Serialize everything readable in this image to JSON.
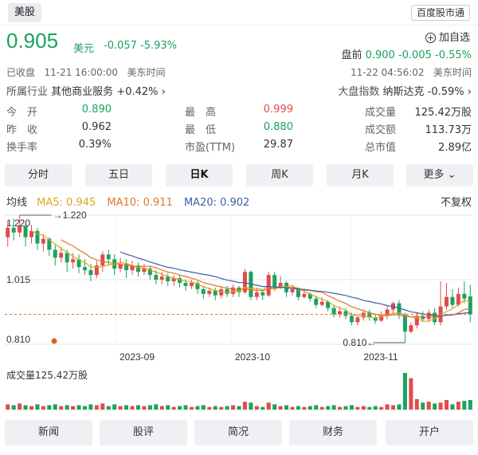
{
  "header": {
    "tab": "美股",
    "brand": "百度股市通"
  },
  "quote": {
    "price": "0.905",
    "unit": "美元",
    "change": "-0.057 -5.93%",
    "status": "已收盘",
    "time": "11-21 16:00:00",
    "tz": "美东时间",
    "watch_label": "加自选",
    "premarket_label": "盘前",
    "premarket_value": "0.900 -0.005 -0.55%",
    "premarket_time": "11-22 04:56:02",
    "premarket_tz": "美东时间"
  },
  "industry": {
    "label": "所属行业",
    "name": "其他商业服务",
    "change": "+0.42%",
    "arrow": "›"
  },
  "index": {
    "label": "大盘指数",
    "name": "纳斯达克",
    "change": "-0.59%",
    "arrow": "›"
  },
  "stats": [
    [
      {
        "k": "今　开",
        "v": "0.890",
        "color": "#1aa260"
      },
      {
        "k": "最　高",
        "v": "0.999",
        "color": "#e24b4b"
      },
      {
        "k": "成交量",
        "v": "125.42万股",
        "color": "#333333"
      }
    ],
    [
      {
        "k": "昨　收",
        "v": "0.962",
        "color": "#333333"
      },
      {
        "k": "最　低",
        "v": "0.880",
        "color": "#1aa260"
      },
      {
        "k": "成交额",
        "v": "113.73万",
        "color": "#333333"
      }
    ],
    [
      {
        "k": "换手率",
        "v": "0.39%",
        "color": "#333333"
      },
      {
        "k": "市盈(TTM)",
        "v": "29.87",
        "color": "#333333"
      },
      {
        "k": "总市值",
        "v": "2.89亿",
        "color": "#333333"
      }
    ]
  ],
  "periods": [
    "分时",
    "五日",
    "日K",
    "周K",
    "月K",
    "更多"
  ],
  "active_period": "日K",
  "ma": {
    "label": "均线",
    "ma5": "MA5: 0.945",
    "ma10": "MA10: 0.911",
    "ma20": "MA20: 0.902",
    "adjust": "不复权"
  },
  "colors": {
    "up": "#e24b4b",
    "down": "#1aa260",
    "ma5": "#d8a820",
    "ma10": "#e0772a",
    "ma20": "#3e5fa8"
  },
  "chart_data": {
    "type": "candlestick",
    "ylim": [
      0.81,
      1.22
    ],
    "y_ticks": [
      "1.220",
      "1.015",
      "0.810"
    ],
    "max_label": "1.220",
    "min_label": "0.810",
    "last_close": 0.905,
    "x_ticks": [
      "2023-09",
      "2023-10",
      "2023-11"
    ],
    "volume_label": "成交量125.42万股",
    "candles": [
      [
        1.15,
        1.18,
        1.2,
        1.12,
        0.6
      ],
      [
        1.18,
        1.165,
        1.21,
        1.14,
        0.5
      ],
      [
        1.165,
        1.185,
        1.22,
        1.15,
        0.7
      ],
      [
        1.185,
        1.15,
        1.195,
        1.12,
        0.5
      ],
      [
        1.15,
        1.17,
        1.19,
        1.13,
        0.4
      ],
      [
        1.17,
        1.13,
        1.18,
        1.11,
        0.6
      ],
      [
        1.13,
        1.145,
        1.16,
        1.105,
        0.4
      ],
      [
        1.145,
        1.11,
        1.15,
        1.09,
        0.5
      ],
      [
        1.11,
        1.085,
        1.125,
        1.06,
        0.6
      ],
      [
        1.085,
        1.1,
        1.12,
        1.07,
        0.4
      ],
      [
        1.1,
        1.07,
        1.11,
        1.04,
        0.5
      ],
      [
        1.07,
        1.08,
        1.1,
        1.05,
        0.4
      ],
      [
        1.08,
        1.055,
        1.095,
        1.035,
        0.5
      ],
      [
        1.055,
        1.045,
        1.08,
        1.03,
        0.4
      ],
      [
        1.045,
        1.03,
        1.065,
        1.01,
        0.6
      ],
      [
        1.03,
        1.06,
        1.075,
        1.02,
        0.5
      ],
      [
        1.06,
        1.095,
        1.105,
        1.04,
        0.7
      ],
      [
        1.095,
        1.08,
        1.11,
        1.06,
        0.4
      ],
      [
        1.08,
        1.05,
        1.095,
        1.03,
        0.6
      ],
      [
        1.05,
        1.065,
        1.085,
        1.04,
        0.4
      ],
      [
        1.065,
        1.045,
        1.08,
        1.02,
        0.5
      ],
      [
        1.045,
        1.06,
        1.075,
        1.03,
        0.4
      ],
      [
        1.06,
        1.04,
        1.07,
        1.025,
        0.5
      ],
      [
        1.04,
        1.05,
        1.065,
        1.03,
        0.4
      ],
      [
        1.05,
        1.03,
        1.06,
        1.015,
        0.5
      ],
      [
        1.03,
        1.015,
        1.045,
        1.0,
        0.6
      ],
      [
        1.015,
        1.025,
        1.04,
        1.0,
        0.4
      ],
      [
        1.025,
        1.01,
        1.035,
        0.995,
        0.5
      ],
      [
        1.01,
        1.02,
        1.03,
        0.995,
        0.3
      ],
      [
        1.02,
        1.005,
        1.03,
        0.99,
        0.4
      ],
      [
        1.005,
        0.995,
        1.015,
        0.98,
        0.5
      ],
      [
        0.995,
        1.005,
        1.015,
        0.985,
        0.3
      ],
      [
        1.005,
        0.985,
        1.01,
        0.97,
        0.4
      ],
      [
        0.985,
        0.97,
        0.995,
        0.955,
        0.5
      ],
      [
        0.97,
        0.98,
        0.99,
        0.96,
        0.3
      ],
      [
        0.98,
        0.965,
        0.99,
        0.95,
        0.4
      ],
      [
        0.965,
        0.985,
        0.995,
        0.955,
        0.3
      ],
      [
        0.985,
        0.97,
        0.995,
        0.96,
        0.4
      ],
      [
        0.97,
        0.99,
        1.0,
        0.96,
        0.5
      ],
      [
        0.99,
        0.975,
        0.995,
        0.96,
        0.4
      ],
      [
        0.975,
        1.04,
        1.05,
        0.97,
        0.9
      ],
      [
        1.04,
        0.96,
        1.045,
        0.95,
        0.8
      ],
      [
        0.96,
        0.975,
        0.99,
        0.95,
        0.4
      ],
      [
        0.975,
        0.965,
        0.985,
        0.95,
        0.3
      ],
      [
        0.965,
        1.03,
        1.04,
        0.96,
        0.8
      ],
      [
        1.03,
        0.99,
        1.04,
        0.98,
        0.6
      ],
      [
        0.99,
        1.005,
        1.025,
        0.985,
        0.4
      ],
      [
        1.005,
        0.975,
        1.01,
        0.96,
        0.5
      ],
      [
        0.975,
        0.985,
        0.995,
        0.965,
        0.3
      ],
      [
        0.985,
        0.96,
        0.99,
        0.95,
        0.4
      ],
      [
        0.96,
        0.97,
        0.98,
        0.955,
        0.3
      ],
      [
        0.97,
        0.955,
        0.975,
        0.945,
        0.4
      ],
      [
        0.955,
        0.935,
        0.965,
        0.925,
        0.5
      ],
      [
        0.935,
        0.945,
        0.96,
        0.93,
        0.3
      ],
      [
        0.945,
        0.925,
        0.95,
        0.915,
        0.4
      ],
      [
        0.925,
        0.905,
        0.935,
        0.895,
        0.5
      ],
      [
        0.905,
        0.915,
        0.93,
        0.895,
        0.3
      ],
      [
        0.915,
        0.9,
        0.925,
        0.89,
        0.4
      ],
      [
        0.9,
        0.88,
        0.91,
        0.87,
        0.5
      ],
      [
        0.88,
        0.895,
        0.905,
        0.87,
        0.3
      ],
      [
        0.895,
        0.91,
        0.92,
        0.885,
        0.4
      ],
      [
        0.91,
        0.895,
        0.92,
        0.885,
        0.3
      ],
      [
        0.895,
        0.885,
        0.905,
        0.875,
        0.4
      ],
      [
        0.885,
        0.9,
        0.915,
        0.88,
        0.3
      ],
      [
        0.9,
        0.92,
        0.93,
        0.89,
        0.6
      ],
      [
        0.92,
        0.94,
        0.945,
        0.905,
        0.5
      ],
      [
        0.94,
        0.905,
        0.95,
        0.89,
        0.6
      ],
      [
        0.905,
        0.85,
        0.91,
        0.815,
        4.2
      ],
      [
        0.85,
        0.87,
        0.88,
        0.845,
        3.6
      ],
      [
        0.87,
        0.9,
        0.91,
        0.86,
        1.2
      ],
      [
        0.9,
        0.89,
        0.915,
        0.88,
        0.8
      ],
      [
        0.89,
        0.91,
        0.92,
        0.88,
        0.9
      ],
      [
        0.91,
        0.88,
        0.925,
        0.87,
        0.7
      ],
      [
        0.88,
        0.93,
        1.01,
        0.87,
        0.8
      ],
      [
        0.93,
        0.96,
        1.005,
        0.92,
        1.1
      ],
      [
        0.96,
        0.935,
        0.985,
        0.925,
        0.6
      ],
      [
        0.935,
        0.97,
        0.99,
        0.93,
        0.9
      ],
      [
        0.97,
        0.955,
        1.01,
        0.94,
        1.0
      ],
      [
        0.962,
        0.905,
        0.999,
        0.88,
        1.1
      ]
    ]
  },
  "bottom_nav": [
    "新闻",
    "股评",
    "简况",
    "财务",
    "开户"
  ]
}
